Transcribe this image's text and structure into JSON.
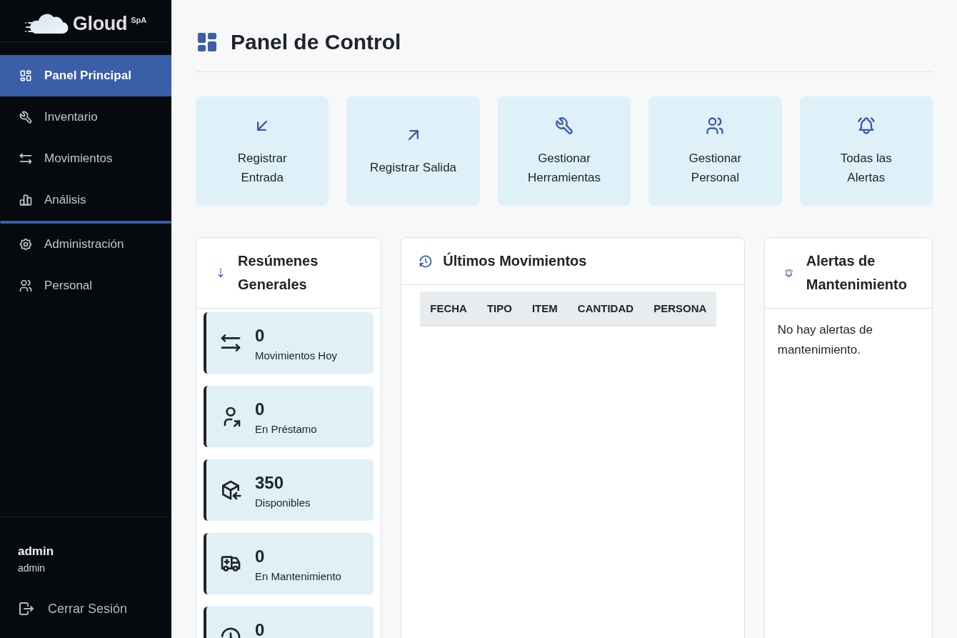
{
  "sidebar": {
    "logo": {
      "name": "Gloud",
      "suffix": "SpA"
    },
    "nav": [
      {
        "items": [
          {
            "label": "Panel Principal",
            "selected": true
          },
          {
            "label": "Inventario",
            "selected": false
          },
          {
            "label": "Movimientos",
            "selected": false
          },
          {
            "label": "Análisis",
            "selected": false
          }
        ]
      },
      {
        "items": [
          {
            "label": "Administración",
            "selected": false
          },
          {
            "label": "Personal",
            "selected": false
          }
        ]
      }
    ],
    "user": {
      "name": "admin",
      "role": "admin"
    },
    "logout": {
      "label": "Cerrar Sesión"
    }
  },
  "header": {
    "title": "Panel de Control"
  },
  "quick_actions": [
    {
      "label": "Registrar Entrada"
    },
    {
      "label": "Registrar Salida"
    },
    {
      "label": "Gestionar Herramientas"
    },
    {
      "label": "Gestionar Personal"
    },
    {
      "label": "Todas las Alertas"
    }
  ],
  "summary": {
    "title": "Resúmenes Generales",
    "stats": [
      {
        "value": "0",
        "label": "Movimientos Hoy"
      },
      {
        "value": "0",
        "label": "En Préstamo"
      },
      {
        "value": "350",
        "label": "Disponibles"
      },
      {
        "value": "0",
        "label": "En Mantenimiento"
      },
      {
        "value": "0"
      }
    ]
  },
  "movements": {
    "title": "Últimos Movimientos",
    "columns": [
      "FECHA",
      "TIPO",
      "ITEM",
      "CANTIDAD",
      "PERSONA"
    ]
  },
  "alerts": {
    "title": "Alertas de Mantenimiento",
    "empty_text": "No hay alertas de mantenimiento."
  }
}
